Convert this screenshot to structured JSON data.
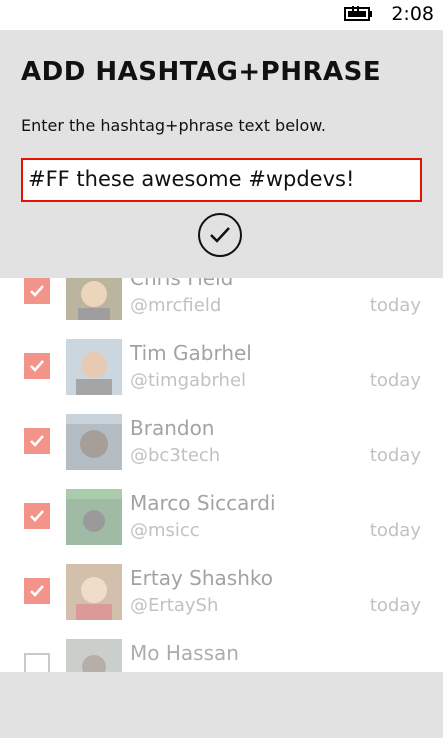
{
  "status_bar": {
    "time": "2:08",
    "battery_icon": "battery-charging-icon"
  },
  "dialog": {
    "title": "ADD HASHTAG+PHRASE",
    "instruction": "Enter the hashtag+phrase text below.",
    "input_value": "#FF these awesome #wpdevs!",
    "confirm_icon": "checkmark-icon"
  },
  "list": {
    "items": [
      {
        "name": "Chris Field",
        "handle": "@mrcfield",
        "time": "today",
        "checked": true
      },
      {
        "name": "Tim Gabrhel",
        "handle": "@timgabrhel",
        "time": "today",
        "checked": true
      },
      {
        "name": "Brandon",
        "handle": "@bc3tech",
        "time": "today",
        "checked": true
      },
      {
        "name": "Marco Siccardi",
        "handle": "@msicc",
        "time": "today",
        "checked": true
      },
      {
        "name": "Ertay Shashko",
        "handle": "@ErtaySh",
        "time": "today",
        "checked": true
      },
      {
        "name": "Mo Hassan",
        "handle": "",
        "time": "",
        "checked": false
      }
    ]
  },
  "colors": {
    "accent": "#e51400",
    "dialog_bg": "#e2e2e2"
  }
}
